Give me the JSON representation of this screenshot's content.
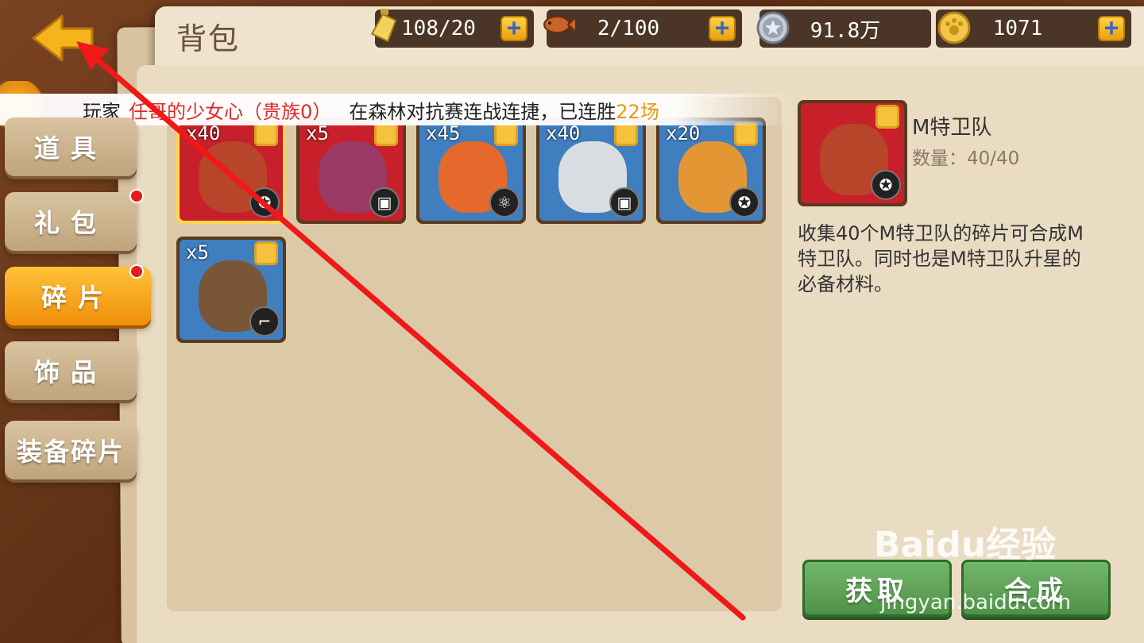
{
  "header": {
    "title": "背包"
  },
  "resources": [
    {
      "icon": "bottle-icon",
      "value": "108/20"
    },
    {
      "icon": "fish-icon",
      "value": "2/100"
    },
    {
      "icon": "silver-coin-icon",
      "value": "91.8万"
    },
    {
      "icon": "gold-paw-coin-icon",
      "value": "1071"
    }
  ],
  "plus_label": "+",
  "ticker": {
    "player_label": "玩家",
    "player_name": "任哥的少女心（贵族0）",
    "message": "在森林对抗赛连战连捷，已连胜",
    "streak": "22场"
  },
  "sidebar": {
    "items": [
      {
        "label": "道具",
        "badge": false
      },
      {
        "label": "礼包",
        "badge": true
      },
      {
        "label": "碎片",
        "badge": true,
        "active": true
      },
      {
        "label": "饰品",
        "badge": false
      },
      {
        "label": "装备碎片",
        "badge": false
      }
    ]
  },
  "fragments": [
    {
      "count": "x40",
      "badge_icon": "laurel-star-icon",
      "selected": true
    },
    {
      "count": "x5",
      "badge_icon": "tank-icon",
      "selected": false
    },
    {
      "count": "x45",
      "badge_icon": "atom-icon",
      "selected": false
    },
    {
      "count": "x40",
      "badge_icon": "tank-icon",
      "selected": false
    },
    {
      "count": "x20",
      "badge_icon": "laurel-star-icon",
      "selected": false
    },
    {
      "count": "x5",
      "badge_icon": "pistol-icon",
      "selected": false
    }
  ],
  "detail": {
    "name": "M特卫队",
    "quantity": "数量：40/40",
    "description": "收集40个M特卫队的碎片可合成M特卫队。同时也是M特卫队升星的必备材料。"
  },
  "buttons": {
    "obtain": "获取",
    "compose": "合成"
  },
  "watermark": {
    "brand": "Baidu经验",
    "url": "jingyan.baidu.com"
  },
  "colors": {
    "accent_orange": "#ef8f0a",
    "button_green": "#4e9148",
    "ticker_name_red": "#e02828",
    "ticker_streak_orange": "#e69a10",
    "annotation_arrow_red": "#f01818"
  }
}
